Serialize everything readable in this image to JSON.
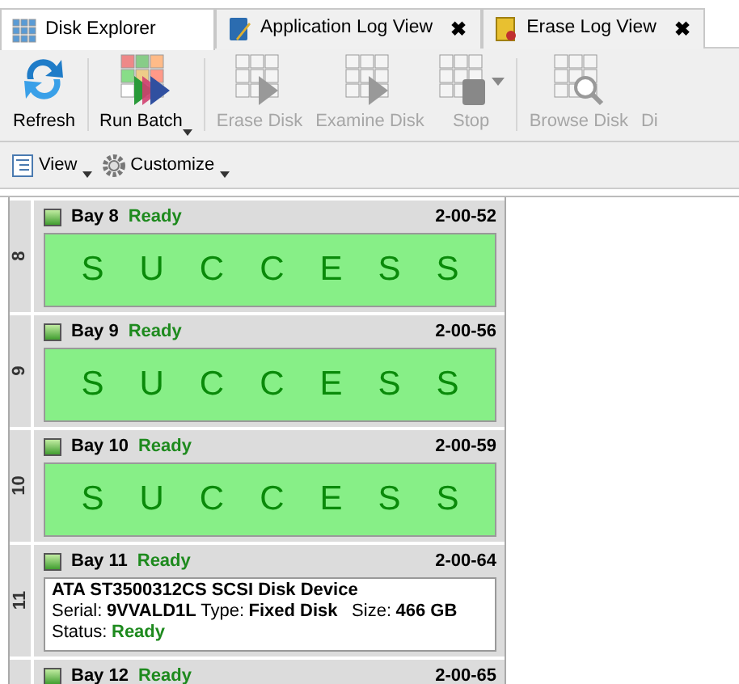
{
  "tabs": [
    {
      "label": "Disk Explorer",
      "selected": true,
      "closable": false
    },
    {
      "label": "Application Log View",
      "selected": false,
      "closable": true
    },
    {
      "label": "Erase Log View",
      "selected": false,
      "closable": true
    }
  ],
  "close_glyph": "✖",
  "toolbar": [
    {
      "kind": "refresh",
      "disabled": false,
      "label_text": "Refresh",
      "dropdown": false
    },
    {
      "kind": "batch",
      "disabled": false,
      "label_text": "Run Batch",
      "dropdown": true
    },
    {
      "kind": "erase",
      "disabled": true,
      "label_text": "Erase Disk",
      "dropdown": false
    },
    {
      "kind": "examine",
      "disabled": true,
      "label_text": "Examine Disk",
      "dropdown": false
    },
    {
      "kind": "stop",
      "disabled": true,
      "label_text": "Stop",
      "dropdown": true
    },
    {
      "kind": "browse",
      "disabled": true,
      "label_text": "Browse Disk",
      "dropdown": false
    },
    {
      "kind": "cut",
      "disabled": true,
      "label_text": "Di",
      "dropdown": false
    }
  ],
  "sub_toolbar": [
    {
      "kind": "view",
      "label": "View"
    },
    {
      "kind": "customize",
      "label": "Customize"
    }
  ],
  "bays": [
    {
      "number": "8",
      "name": "Bay 8",
      "status": "Ready",
      "code": "2-00-52",
      "kind": "success",
      "result": "SUCCESS"
    },
    {
      "number": "9",
      "name": "Bay 9",
      "status": "Ready",
      "code": "2-00-56",
      "kind": "success",
      "result": "SUCCESS"
    },
    {
      "number": "10",
      "name": "Bay 10",
      "status": "Ready",
      "code": "2-00-59",
      "kind": "success",
      "result": "SUCCESS"
    },
    {
      "number": "11",
      "name": "Bay 11",
      "status": "Ready",
      "code": "2-00-64",
      "kind": "details",
      "device": "ATA ST3500312CS SCSI Disk Device",
      "serial_label": "Serial:",
      "serial": "9VVALD1L",
      "type_label": "Type:",
      "type": "Fixed Disk",
      "size_label": "Size:",
      "size": "466 GB",
      "status_label": "Status:",
      "status_value": "Ready"
    },
    {
      "name": "Bay 12",
      "status": "Ready",
      "code": "2-00-65",
      "kind": "header"
    }
  ]
}
